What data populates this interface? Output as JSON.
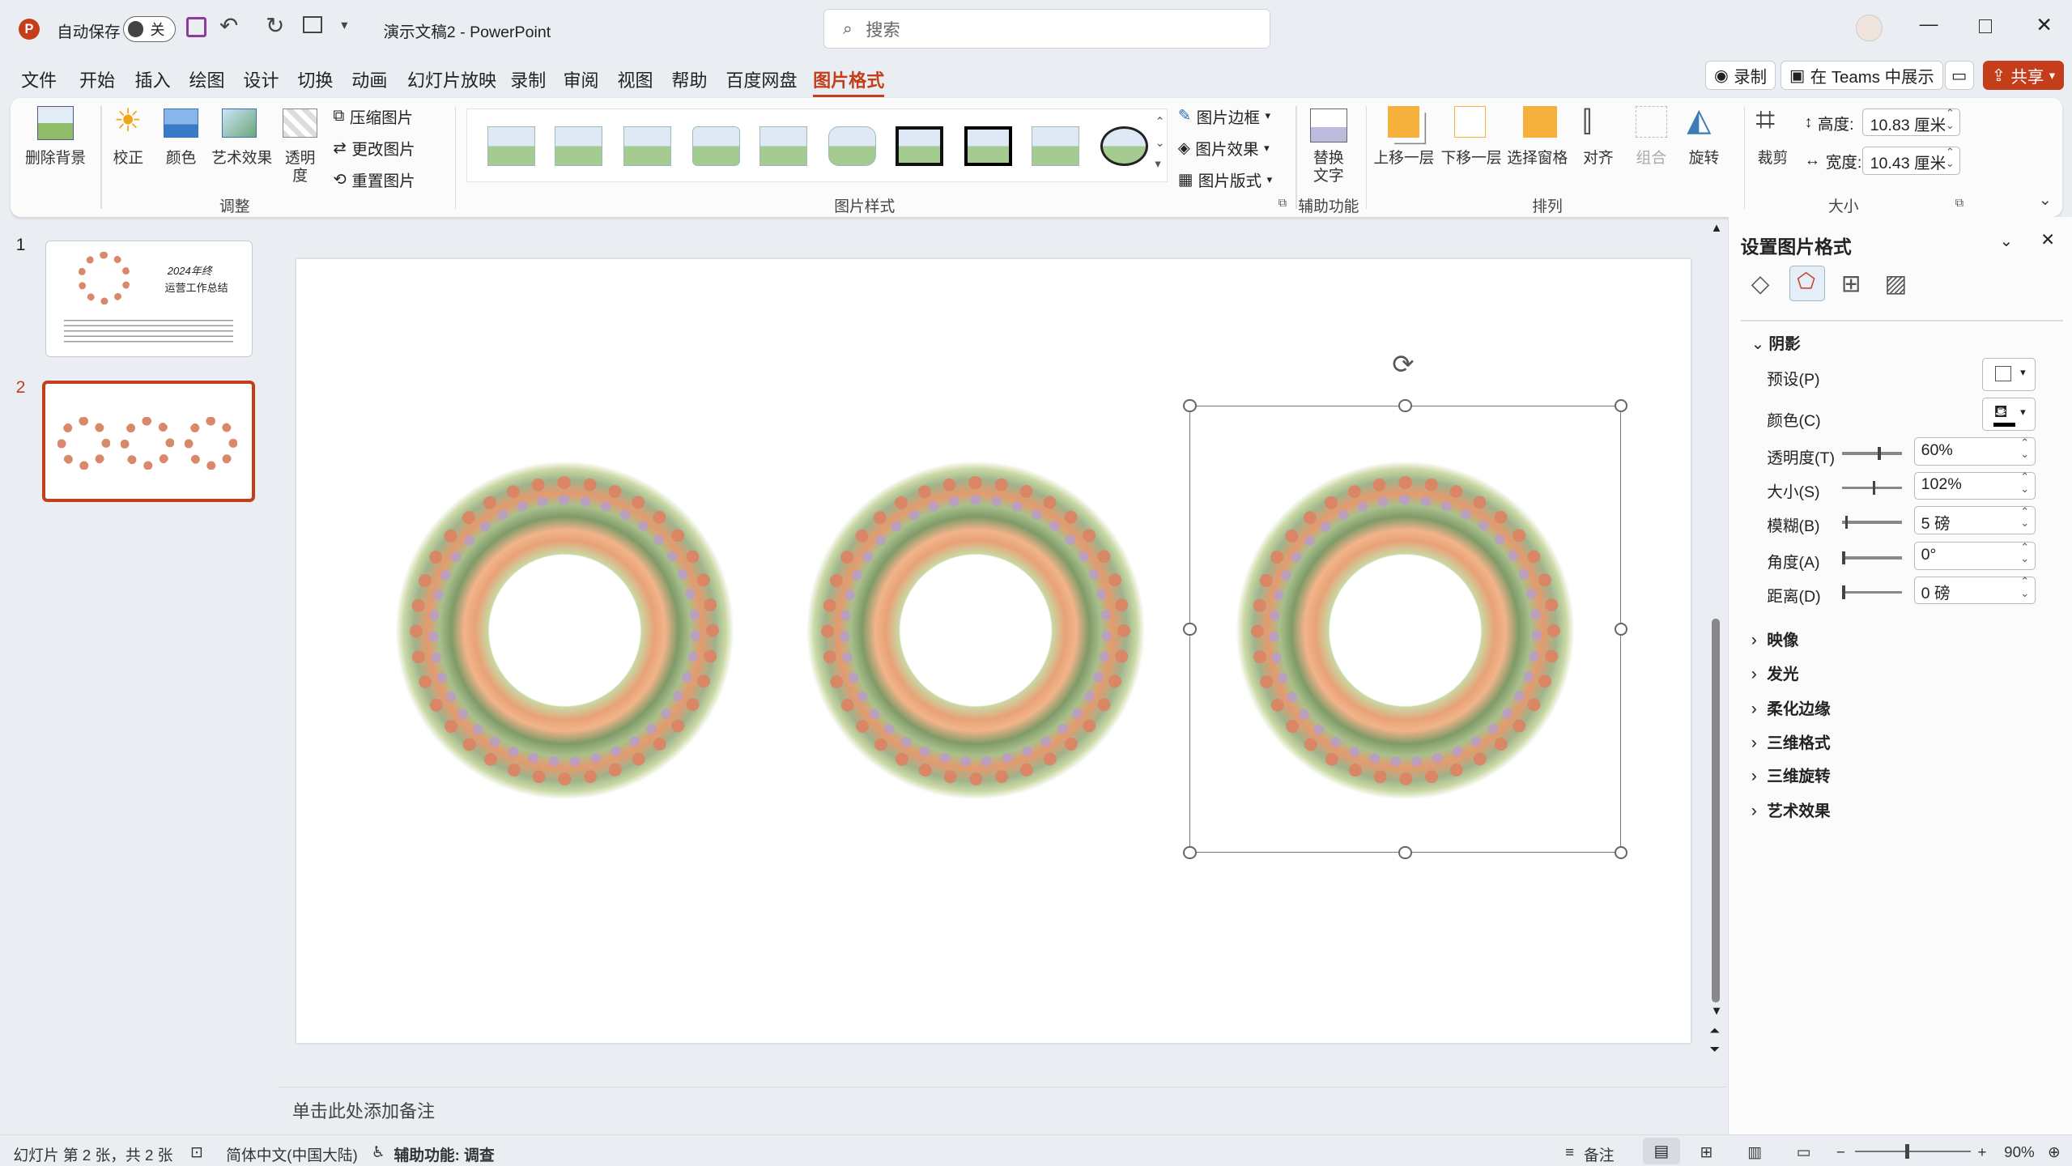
{
  "titlebar": {
    "autosave": "自动保存",
    "toggle": "关",
    "doc_title": "演示文稿2 - PowerPoint",
    "search_placeholder": "搜索"
  },
  "menus": [
    "文件",
    "开始",
    "插入",
    "绘图",
    "设计",
    "切换",
    "动画",
    "幻灯片放映",
    "录制",
    "审阅",
    "视图",
    "帮助",
    "百度网盘",
    "图片格式"
  ],
  "right_buttons": {
    "record": "录制",
    "teams": "在 Teams 中展示",
    "share": "共享"
  },
  "ribbon": {
    "adjust": {
      "remove_bg": "删除背景",
      "correct": "校正",
      "color": "颜色",
      "art": "艺术效果",
      "transp_1": "透明",
      "transp_2": "度",
      "compress": "压缩图片",
      "change": "更改图片",
      "reset": "重置图片",
      "label": "调整"
    },
    "styles": {
      "border": "图片边框",
      "effects": "图片效果",
      "layout": "图片版式",
      "label": "图片样式"
    },
    "access": {
      "alt_1": "替换",
      "alt_2": "文字",
      "label": "辅助功能"
    },
    "arrange": {
      "forward": "上移一层",
      "backward": "下移一层",
      "pane": "选择窗格",
      "align": "对齐",
      "group": "组合",
      "rotate": "旋转",
      "label": "排列"
    },
    "size": {
      "crop": "裁剪",
      "height_lbl": "高度:",
      "height": "10.83 厘米",
      "width_lbl": "宽度:",
      "width": "10.43 厘米",
      "label": "大小"
    }
  },
  "slides": [
    {
      "num": "1",
      "t1": "2024年终",
      "t2": "运营工作总结"
    },
    {
      "num": "2"
    }
  ],
  "notes": "单击此处添加备注",
  "pane": {
    "title": "设置图片格式",
    "shadow": "阴影",
    "preset": "预设(P)",
    "color": "颜色(C)",
    "transparency_lbl": "透明度(T)",
    "transparency": "60%",
    "size_lbl": "大小(S)",
    "size": "102%",
    "blur_lbl": "模糊(B)",
    "blur": "5 磅",
    "angle_lbl": "角度(A)",
    "angle": "0°",
    "distance_lbl": "距离(D)",
    "distance": "0 磅",
    "sections": [
      "映像",
      "发光",
      "柔化边缘",
      "三维格式",
      "三维旋转",
      "艺术效果"
    ]
  },
  "status": {
    "slide": "幻灯片 第 2 张，共 2 张",
    "lang": "简体中文(中国大陆)",
    "access": "辅助功能: 调查",
    "notes": "备注",
    "zoom": "90%"
  },
  "colors": {
    "accent": "#c43e1c",
    "share": "#c43e1c"
  }
}
